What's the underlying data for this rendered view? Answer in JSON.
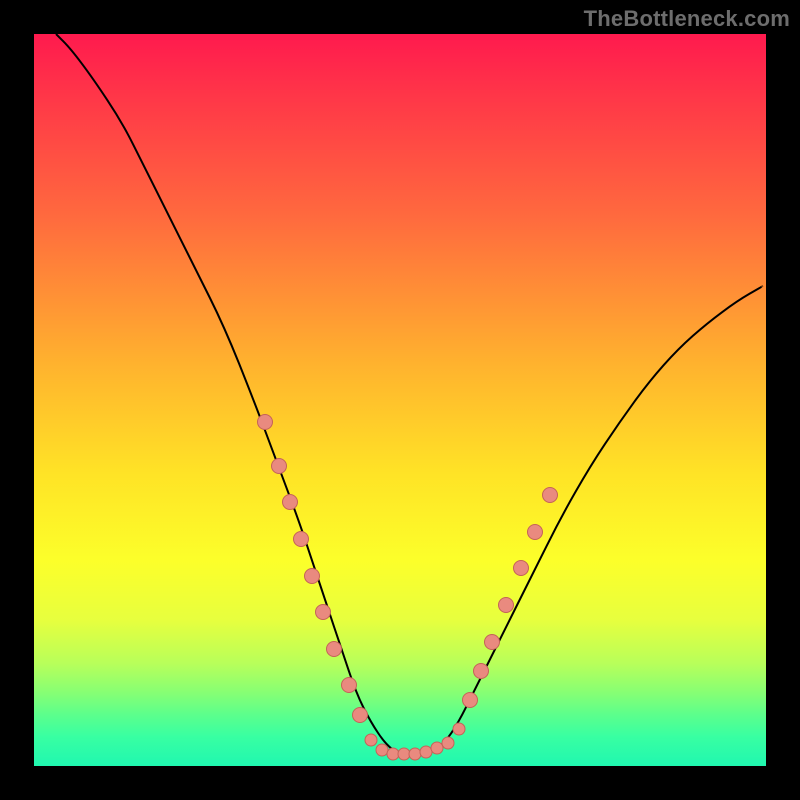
{
  "watermark": "TheBottleneck.com",
  "colors": {
    "frame": "#000000",
    "curve": "#000000",
    "dot_fill": "#e98a7f",
    "dot_stroke": "#c46358"
  },
  "chart_data": {
    "type": "line",
    "title": "",
    "xlabel": "",
    "ylabel": "",
    "xlim": [
      0,
      100
    ],
    "ylim": [
      0,
      100
    ],
    "grid": false,
    "legend": false,
    "series": [
      {
        "name": "bottleneck-curve",
        "x": [
          3,
          5,
          8,
          12,
          15,
          18,
          22,
          26,
          30,
          33,
          36,
          38,
          40,
          42,
          44,
          46,
          48,
          50,
          52,
          54,
          56,
          58,
          60,
          64,
          68,
          72,
          76,
          80,
          84,
          88,
          92,
          96,
          99.5
        ],
        "y": [
          100,
          98,
          94,
          88,
          82,
          76,
          68,
          60,
          50,
          42,
          34,
          28,
          22,
          16,
          10,
          6,
          3,
          1.5,
          1.5,
          1.8,
          3,
          6,
          10,
          18,
          26,
          34,
          41,
          47,
          52.5,
          57,
          60.5,
          63.5,
          65.5
        ]
      }
    ],
    "scatter": [
      {
        "name": "left-dot-cluster",
        "points": [
          {
            "x": 31.5,
            "y": 47
          },
          {
            "x": 33.5,
            "y": 41
          },
          {
            "x": 35,
            "y": 36
          },
          {
            "x": 36.5,
            "y": 31
          },
          {
            "x": 38,
            "y": 26
          },
          {
            "x": 39.5,
            "y": 21
          },
          {
            "x": 41,
            "y": 16
          },
          {
            "x": 43,
            "y": 11
          },
          {
            "x": 44.5,
            "y": 7
          }
        ]
      },
      {
        "name": "bottom-dot-strip",
        "points": [
          {
            "x": 46,
            "y": 3.5
          },
          {
            "x": 47.5,
            "y": 2.2
          },
          {
            "x": 49,
            "y": 1.7
          },
          {
            "x": 50.5,
            "y": 1.6
          },
          {
            "x": 52,
            "y": 1.7
          },
          {
            "x": 53.5,
            "y": 1.9
          },
          {
            "x": 55,
            "y": 2.4
          },
          {
            "x": 56.5,
            "y": 3.2
          },
          {
            "x": 58,
            "y": 5
          }
        ]
      },
      {
        "name": "right-dot-cluster",
        "points": [
          {
            "x": 59.5,
            "y": 9
          },
          {
            "x": 61,
            "y": 13
          },
          {
            "x": 62.5,
            "y": 17
          },
          {
            "x": 64.5,
            "y": 22
          },
          {
            "x": 66.5,
            "y": 27
          },
          {
            "x": 68.5,
            "y": 32
          },
          {
            "x": 70.5,
            "y": 37
          }
        ]
      }
    ]
  }
}
